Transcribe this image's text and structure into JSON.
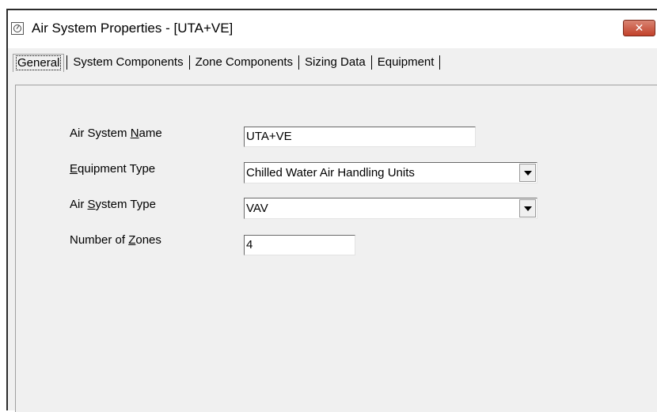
{
  "window": {
    "title": "Air System Properties - [UTA+VE]",
    "close_label": "✕"
  },
  "tabs": [
    {
      "label": "General",
      "active": true
    },
    {
      "label": "System Components"
    },
    {
      "label": "Zone Components"
    },
    {
      "label": "Sizing Data"
    },
    {
      "label": "Equipment"
    }
  ],
  "form": {
    "air_system_name": {
      "label_pre": "Air System ",
      "label_accel": "N",
      "label_post": "ame",
      "value": "UTA+VE"
    },
    "equipment_type": {
      "label_pre": "",
      "label_accel": "E",
      "label_post": "quipment Type",
      "value": "Chilled Water Air Handling Units"
    },
    "air_system_type": {
      "label_pre": "Air ",
      "label_accel": "S",
      "label_post": "ystem Type",
      "value": "VAV"
    },
    "number_of_zones": {
      "label_pre": "Number of ",
      "label_accel": "Z",
      "label_post": "ones",
      "value": "4"
    }
  }
}
